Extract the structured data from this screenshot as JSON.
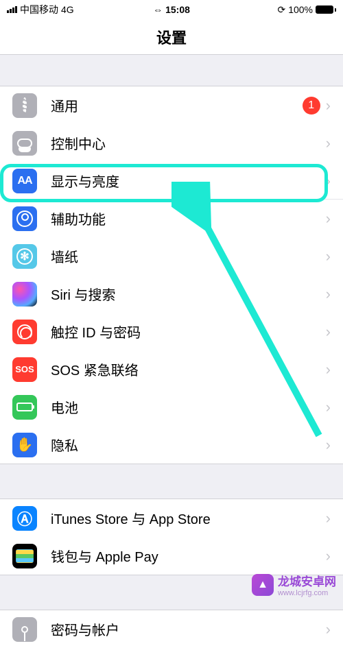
{
  "status": {
    "carrier": "中国移动",
    "network": "4G",
    "time": "15:08",
    "hotspot_icon": "⇔",
    "orientation_lock": "⟳",
    "battery_pct": "100%"
  },
  "header": {
    "title": "设置"
  },
  "group1": {
    "items": [
      {
        "id": "general",
        "label": "通用",
        "icon_name": "gear-icon",
        "icon_bg": "#b0b0b7",
        "badge": "1"
      },
      {
        "id": "control-center",
        "label": "控制中心",
        "icon_name": "toggle-icon",
        "icon_bg": "#b0b0b7",
        "badge": null
      },
      {
        "id": "display-brightness",
        "label": "显示与亮度",
        "icon_name": "aa-icon",
        "icon_bg": "#2b6ff0",
        "badge": null,
        "highlighted": true
      },
      {
        "id": "accessibility",
        "label": "辅助功能",
        "icon_name": "person-circle-icon",
        "icon_bg": "#2b6ff0",
        "badge": null
      },
      {
        "id": "wallpaper",
        "label": "墙纸",
        "icon_name": "flower-icon",
        "icon_bg": "#55c8e8",
        "badge": null
      },
      {
        "id": "siri-search",
        "label": "Siri 与搜索",
        "icon_name": "siri-icon",
        "icon_bg": "#000",
        "badge": null
      },
      {
        "id": "touchid",
        "label": "触控 ID 与密码",
        "icon_name": "fingerprint-icon",
        "icon_bg": "#ff3b30",
        "badge": null
      },
      {
        "id": "sos",
        "label": "SOS 紧急联络",
        "icon_name": "sos-icon",
        "icon_bg": "#ff3b30",
        "badge": null
      },
      {
        "id": "battery",
        "label": "电池",
        "icon_name": "battery-icon",
        "icon_bg": "#34c759",
        "badge": null
      },
      {
        "id": "privacy",
        "label": "隐私",
        "icon_name": "hand-icon",
        "icon_bg": "#2b6ff0",
        "badge": null
      }
    ]
  },
  "group2": {
    "items": [
      {
        "id": "itunes",
        "label": "iTunes Store 与 App Store",
        "icon_name": "appstore-icon",
        "icon_bg": "#0a84ff",
        "badge": null
      },
      {
        "id": "wallet",
        "label": "钱包与 Apple Pay",
        "icon_name": "wallet-icon",
        "icon_bg": "#000",
        "badge": null
      }
    ]
  },
  "group3": {
    "items": [
      {
        "id": "accounts",
        "label": "密码与帐户",
        "icon_name": "key-icon",
        "icon_bg": "#b0b0b7",
        "badge": null
      }
    ]
  },
  "watermark": {
    "name": "龙城安卓网",
    "url": "www.lcjrfg.com"
  },
  "annotation": {
    "highlight_color": "#1de9d3",
    "arrow_from": "bottom-right",
    "arrow_to": "display-brightness-row"
  }
}
